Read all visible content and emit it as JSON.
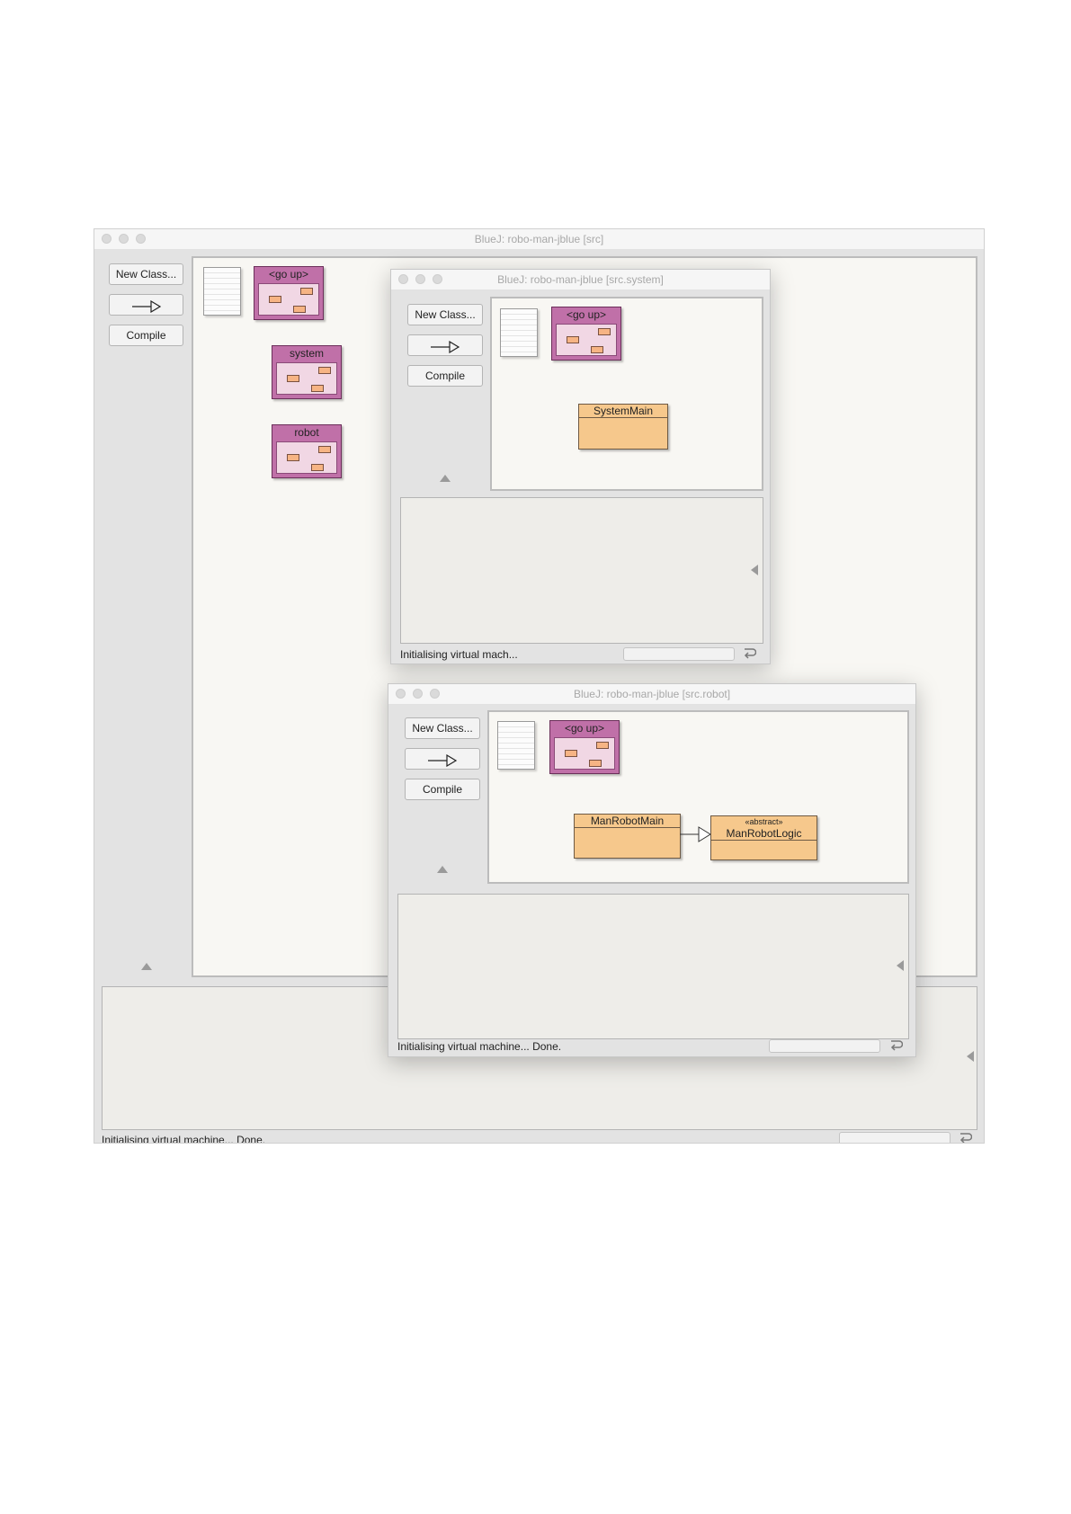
{
  "main": {
    "title": "BlueJ:  robo-man-jblue  [src]",
    "buttons": {
      "new_class": "New Class...",
      "compile": "Compile"
    },
    "packages": {
      "go_up": "<go up>",
      "system": "system",
      "robot": "robot"
    },
    "status": "Initialising virtual machine... Done."
  },
  "system_window": {
    "title": "BlueJ:  robo-man-jblue  [src.system]",
    "buttons": {
      "new_class": "New Class...",
      "compile": "Compile"
    },
    "packages": {
      "go_up": "<go up>"
    },
    "classes": {
      "system_main": "SystemMain"
    },
    "status": "Initialising virtual mach..."
  },
  "robot_window": {
    "title": "BlueJ:  robo-man-jblue  [src.robot]",
    "buttons": {
      "new_class": "New Class...",
      "compile": "Compile"
    },
    "packages": {
      "go_up": "<go up>"
    },
    "classes": {
      "man_robot_main": "ManRobotMain",
      "man_robot_logic_stereotype": "«abstract»",
      "man_robot_logic": "ManRobotLogic"
    },
    "status": "Initialising virtual machine... Done."
  },
  "colors": {
    "package_fill": "#c070a8",
    "package_body": "#f1d7e4",
    "class_fill": "#f6c88c",
    "canvas": "#f8f7f3",
    "window_bg": "#e3e3e3"
  },
  "icons": [
    "window-close-dot",
    "window-minimize-dot",
    "window-zoom-dot",
    "inheritance-arrow-icon",
    "readme-doc-icon",
    "package-icon",
    "wrap-text-icon"
  ]
}
